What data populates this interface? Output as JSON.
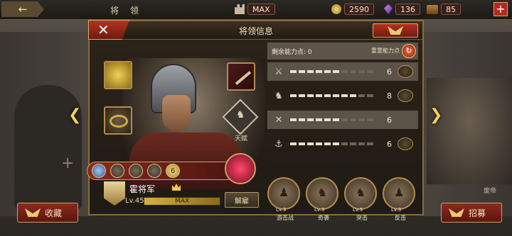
{
  "topbar": {
    "back_icon": "←",
    "title": "将 领",
    "center_label": "MAX",
    "resources": [
      {
        "name": "gold-coin-icon",
        "value": "2590"
      },
      {
        "name": "purple-gem-icon",
        "value": "136"
      },
      {
        "name": "treasure-chest-icon",
        "value": "85"
      }
    ],
    "add_label": "+"
  },
  "dialog": {
    "title": "将领信息",
    "close_label": "✕",
    "talent_label": "天赋",
    "general": {
      "name": "霍将军",
      "level": "Lv.45",
      "xp_label": "MAX",
      "xp_progress": 1.0,
      "dismiss_label": "解雇"
    },
    "gem_slots": [
      "",
      "",
      "",
      "",
      "6"
    ],
    "points": {
      "label": "剩余能力点: 0",
      "reset_label": "重置能力点"
    },
    "stats": [
      {
        "icon": "sword-icon",
        "value": "6",
        "filled": 6,
        "total": 10
      },
      {
        "icon": "horse-icon",
        "value": "8",
        "filled": 8,
        "total": 10
      },
      {
        "icon": "crossed-weapons-icon",
        "value": "6",
        "filled": 6,
        "total": 10
      },
      {
        "icon": "anchor-icon",
        "value": "6",
        "filled": 6,
        "total": 10
      }
    ],
    "skills": [
      {
        "level": "Lv.3",
        "name": "游击战"
      },
      {
        "level": "Lv.3",
        "name": "奇袭"
      },
      {
        "level": "Lv.5",
        "name": "突击"
      },
      {
        "level": "Lv.3",
        "name": "反击"
      }
    ]
  },
  "side": {
    "left_slot_plus": "+",
    "right_name": "废帝"
  },
  "bottom": {
    "favorite_label": "收藏",
    "recruit_label": "招募"
  }
}
